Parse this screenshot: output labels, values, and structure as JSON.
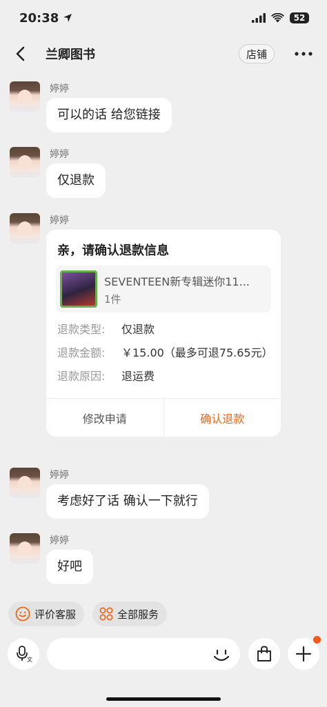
{
  "status_bar": {
    "time": "20:38",
    "battery": "52"
  },
  "nav": {
    "title": "兰卿图书",
    "store_label": "店铺"
  },
  "messages": [
    {
      "sender": "婷婷",
      "text": "可以的话 给您链接"
    },
    {
      "sender": "婷婷",
      "text": "仅退款"
    },
    {
      "sender": "婷婷",
      "card": {
        "title": "亲，请确认退款信息",
        "product_name": "SEVENTEEN新专辑迷你11...",
        "product_qty": "1件",
        "rows": [
          {
            "label": "退款类型:",
            "value": "仅退款"
          },
          {
            "label": "退款金额:",
            "value": "￥15.00（最多可退75.65元）"
          },
          {
            "label": "退款原因:",
            "value": "退运费"
          }
        ],
        "modify_label": "修改申请",
        "confirm_label": "确认退款"
      }
    },
    {
      "sender": "婷婷",
      "text": "考虑好了话 确认一下就行"
    },
    {
      "sender": "婷婷",
      "text": "好吧"
    }
  ],
  "quick_actions": [
    {
      "label": "评价客服",
      "icon": "smiley-icon"
    },
    {
      "label": "全部服务",
      "icon": "grid-services-icon"
    }
  ],
  "input": {
    "placeholder": ""
  },
  "colors": {
    "accent": "#e8671b",
    "background": "#efefef",
    "badge": "#f35a1f"
  }
}
